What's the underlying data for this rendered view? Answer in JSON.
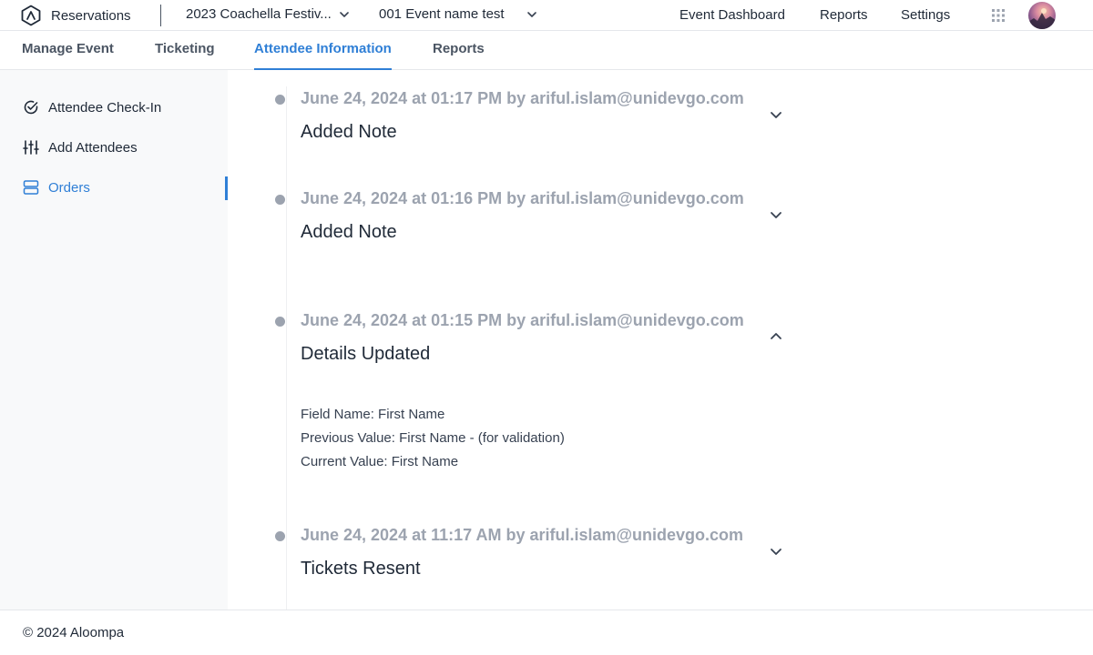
{
  "app": {
    "name": "Reservations",
    "logo_icon": "brand-logo-icon"
  },
  "header": {
    "event_selector": "2023 Coachella Festiv...",
    "event_name_selector": "001 Event name test",
    "nav": [
      "Event Dashboard",
      "Reports",
      "Settings"
    ],
    "apps_icon": "grid-icon"
  },
  "tabs": [
    {
      "label": "Manage Event",
      "active": false
    },
    {
      "label": "Ticketing",
      "active": false
    },
    {
      "label": "Attendee Information",
      "active": true
    },
    {
      "label": "Reports",
      "active": false
    }
  ],
  "sidebar": {
    "items": [
      {
        "label": "Attendee Check-In",
        "icon": "check-circle-icon",
        "active": false
      },
      {
        "label": "Add Attendees",
        "icon": "sliders-icon",
        "active": false
      },
      {
        "label": "Orders",
        "icon": "server-icon",
        "active": true
      }
    ]
  },
  "timeline": [
    {
      "meta": "June 24, 2024 at 01:17 PM by ariful.islam@unidevgo.com",
      "title": "Added Note",
      "expanded": false
    },
    {
      "meta": "June 24, 2024 at 01:16 PM by ariful.islam@unidevgo.com",
      "title": "Added Note",
      "expanded": false
    },
    {
      "meta": "June 24, 2024 at 01:15 PM by ariful.islam@unidevgo.com",
      "title": "Details Updated",
      "expanded": true,
      "details": {
        "field_name": "Field Name: First Name",
        "previous_value": "Previous Value: First Name - (for validation)",
        "current_value": "Current Value: First Name"
      }
    },
    {
      "meta": "June 24, 2024 at 11:17 AM by ariful.islam@unidevgo.com",
      "title": "Tickets Resent",
      "expanded": false
    }
  ],
  "footer": {
    "copyright": "© 2024 Aloompa"
  },
  "colors": {
    "accent": "#2f7fd6",
    "muted": "#9ca3af",
    "sidebar_bg": "#f8f9fa"
  }
}
